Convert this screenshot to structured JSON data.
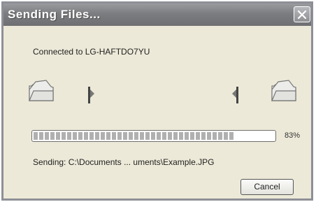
{
  "window": {
    "title": "Sending Files...",
    "close_icon": "close-icon"
  },
  "connection": {
    "label": "Connected to LG-HAFTDO7YU"
  },
  "animation": {
    "source_icon": "folder-icon",
    "destination_icon": "folder-icon",
    "document_icon": "document-icon"
  },
  "progress": {
    "fraction": 0.83,
    "percent_label": "83%"
  },
  "status": {
    "sending_text": "Sending: C:\\Documents ... uments\\Example.JPG"
  },
  "buttons": {
    "cancel_label": "Cancel"
  },
  "colors": {
    "titlebar": "#7c7d80",
    "dialog_background": "#ece9d8",
    "progress_block": "#b0b0b0"
  }
}
